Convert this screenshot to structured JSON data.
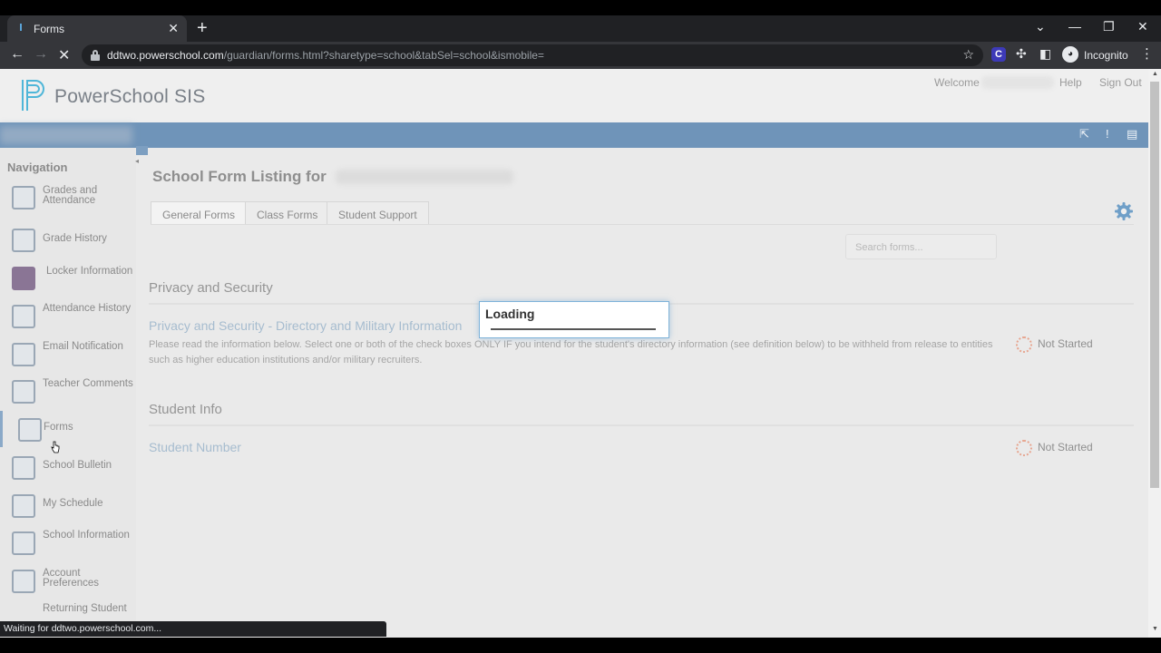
{
  "browser": {
    "tab_title": "Forms",
    "tab_close": "✕",
    "new_tab": "+",
    "url_host": "ddtwo.powerschool.com",
    "url_path": "/guardian/forms.html?sharetype=school&tabSel=school&ismobile=",
    "incognito_label": "Incognito",
    "extension_c": "C",
    "status_text": "Waiting for ddtwo.powerschool.com..."
  },
  "header": {
    "logo_text": "PowerSchool SIS",
    "welcome": "Welcome",
    "help": "Help",
    "sign_out": "Sign Out"
  },
  "sidebar": {
    "heading": "Navigation",
    "items": [
      {
        "label": "Grades and Attendance",
        "icon": "grades-icon"
      },
      {
        "label": "Grade History",
        "icon": "grade-history-icon"
      },
      {
        "label": "Locker Information",
        "icon": "locker-icon"
      },
      {
        "label": "Attendance History",
        "icon": "attendance-icon"
      },
      {
        "label": "Email Notification",
        "icon": "email-icon"
      },
      {
        "label": "Teacher Comments",
        "icon": "comments-icon"
      },
      {
        "label": "Forms",
        "icon": "forms-icon",
        "active": true
      },
      {
        "label": "School Bulletin",
        "icon": "bulletin-icon"
      },
      {
        "label": "My Schedule",
        "icon": "schedule-icon"
      },
      {
        "label": "School Information",
        "icon": "school-icon"
      },
      {
        "label": "Account Preferences",
        "icon": "account-icon"
      },
      {
        "label": "Returning Student",
        "icon": "returning-icon"
      }
    ]
  },
  "content": {
    "page_title": "School Form Listing for",
    "tabs": [
      {
        "label": "General Forms"
      },
      {
        "label": "Class Forms"
      },
      {
        "label": "Student Support"
      }
    ],
    "search_placeholder": "Search forms...",
    "sections": [
      {
        "title": "Privacy and Security",
        "forms": [
          {
            "name": "Privacy and Security - Directory and Military Information",
            "description": "Please read the information below. Select one or both of the check boxes ONLY IF you intend for the student's directory information (see definition below) to be withheld from release to entities such as higher education institutions and/or military recruiters.",
            "status": "Not Started"
          }
        ]
      },
      {
        "title": "Student Info",
        "forms": [
          {
            "name": "Student Number",
            "status": "Not Started"
          }
        ]
      }
    ],
    "loading_text": "Loading"
  },
  "colors": {
    "brand_blue": "#6f94b9",
    "link": "#a6bccf",
    "status_pending": "#e7a58f"
  }
}
